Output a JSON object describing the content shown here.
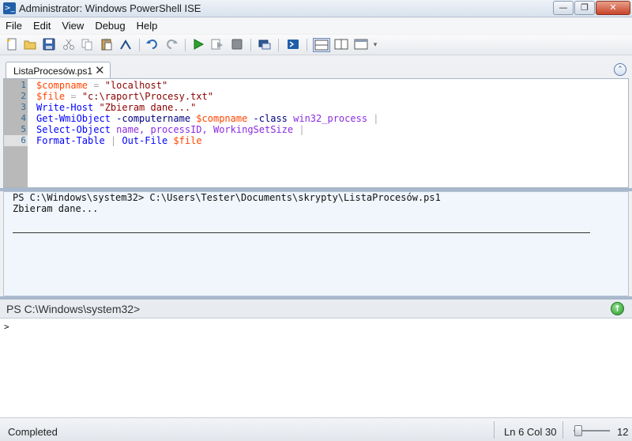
{
  "window": {
    "title": "Administrator: Windows PowerShell ISE",
    "minimize": "—",
    "maximize": "❐",
    "close": "✕"
  },
  "menu": [
    "File",
    "Edit",
    "View",
    "Debug",
    "Help"
  ],
  "toolbar": {
    "icons": [
      "new-file-icon",
      "open-folder-icon",
      "save-icon",
      "cut-icon",
      "copy-icon",
      "paste-icon",
      "clear-icon",
      "undo-icon",
      "redo-icon",
      "run-icon",
      "run-selection-icon",
      "stop-icon",
      "remote-tab-icon",
      "powershell-icon",
      "layout-top-icon",
      "layout-right-icon",
      "layout-max-icon"
    ]
  },
  "editor": {
    "tab_label": "ListaProcesów.ps1",
    "tab_close": "✕",
    "collapse": "⌃",
    "highlighted_line": 6,
    "lines": [
      {
        "n": "1",
        "tokens": [
          {
            "t": "$compname",
            "k": "var"
          },
          {
            "t": " = ",
            "k": "op"
          },
          {
            "t": "\"localhost\"",
            "k": "str"
          }
        ]
      },
      {
        "n": "2",
        "tokens": [
          {
            "t": "$file",
            "k": "var"
          },
          {
            "t": " = ",
            "k": "op"
          },
          {
            "t": "\"c:\\raport\\Procesy.txt\"",
            "k": "str"
          }
        ]
      },
      {
        "n": "3",
        "tokens": [
          {
            "t": "Write-Host",
            "k": "cmd"
          },
          {
            "t": " ",
            "k": "plain"
          },
          {
            "t": "\"Zbieram dane...\"",
            "k": "str"
          }
        ]
      },
      {
        "n": "4",
        "tokens": [
          {
            "t": "Get-WmiObject",
            "k": "cmd"
          },
          {
            "t": " -computername ",
            "k": "param"
          },
          {
            "t": "$compname",
            "k": "var"
          },
          {
            "t": " -class ",
            "k": "param"
          },
          {
            "t": "win32_process",
            "k": "arg"
          },
          {
            "t": " |",
            "k": "op"
          }
        ]
      },
      {
        "n": "5",
        "tokens": [
          {
            "t": "Select-Object",
            "k": "cmd"
          },
          {
            "t": " name, processID, WorkingSetSize",
            "k": "arg"
          },
          {
            "t": " |",
            "k": "op"
          }
        ]
      },
      {
        "n": "6",
        "tokens": [
          {
            "t": "Format-Table",
            "k": "cmd"
          },
          {
            "t": " | ",
            "k": "op"
          },
          {
            "t": "Out-File",
            "k": "cmd"
          },
          {
            "t": " ",
            "k": "plain"
          },
          {
            "t": "$file",
            "k": "var"
          }
        ]
      }
    ]
  },
  "output": {
    "line1": "PS C:\\Windows\\system32> C:\\Users\\Tester\\Documents\\skrypty\\ListaProcesów.ps1",
    "line2": "Zbieram dane..."
  },
  "command": {
    "prompt": "PS C:\\Windows\\system32>",
    "run_symbol": "↑",
    "caret": ">"
  },
  "status": {
    "text": "Completed",
    "position": "Ln 6  Col 30",
    "zoom": "12"
  }
}
